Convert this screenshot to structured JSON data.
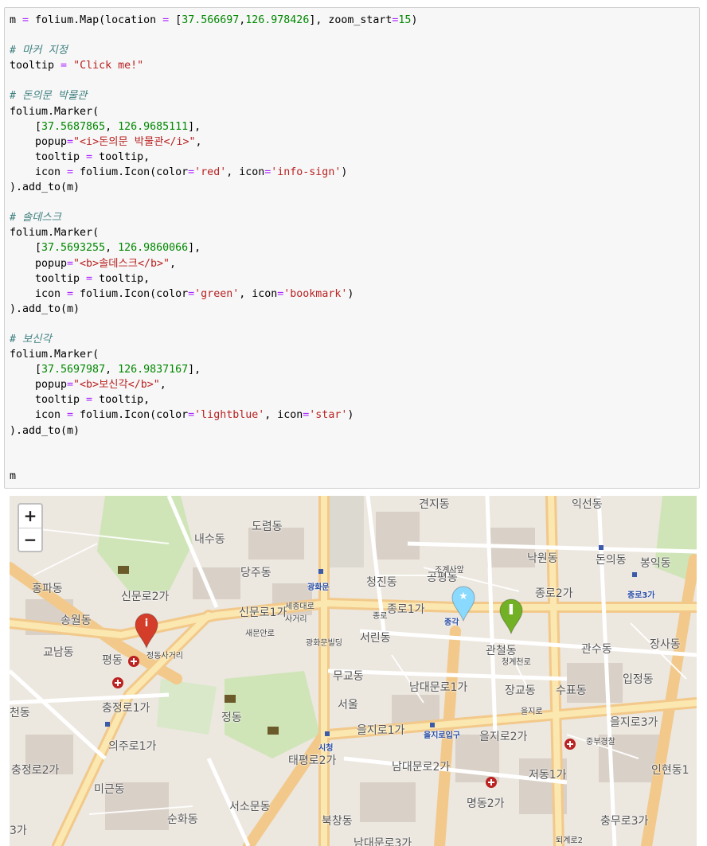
{
  "code_lines": [
    [
      {
        "t": "m "
      },
      {
        "t": "=",
        "c": "op"
      },
      {
        "t": " folium.Map(location "
      },
      {
        "t": "=",
        "c": "op"
      },
      {
        "t": " ["
      },
      {
        "t": "37.566697",
        "c": "num"
      },
      {
        "t": ","
      },
      {
        "t": "126.978426",
        "c": "num"
      },
      {
        "t": "], zoom_start"
      },
      {
        "t": "=",
        "c": "op"
      },
      {
        "t": "15",
        "c": "num"
      },
      {
        "t": ")"
      }
    ],
    [],
    [
      {
        "t": "# 마커 지정",
        "c": "cm"
      }
    ],
    [
      {
        "t": "tooltip "
      },
      {
        "t": "=",
        "c": "op"
      },
      {
        "t": " "
      },
      {
        "t": "\"Click me!\"",
        "c": "str"
      }
    ],
    [],
    [
      {
        "t": "# 돈의문 박물관",
        "c": "cm"
      }
    ],
    [
      {
        "t": "folium.Marker("
      }
    ],
    [
      {
        "i": 1
      },
      {
        "t": "["
      },
      {
        "t": "37.5687865",
        "c": "num"
      },
      {
        "t": ", "
      },
      {
        "t": "126.9685111",
        "c": "num"
      },
      {
        "t": "],"
      }
    ],
    [
      {
        "i": 1
      },
      {
        "t": "popup"
      },
      {
        "t": "=",
        "c": "op"
      },
      {
        "t": "\"<i>돈의문 박물관</i>\"",
        "c": "str"
      },
      {
        "t": ","
      }
    ],
    [
      {
        "i": 1
      },
      {
        "t": "tooltip "
      },
      {
        "t": "=",
        "c": "op"
      },
      {
        "t": " tooltip,"
      }
    ],
    [
      {
        "i": 1
      },
      {
        "t": "icon "
      },
      {
        "t": "=",
        "c": "op"
      },
      {
        "t": " folium.Icon(color"
      },
      {
        "t": "=",
        "c": "op"
      },
      {
        "t": "'red'",
        "c": "str"
      },
      {
        "t": ", icon"
      },
      {
        "t": "=",
        "c": "op"
      },
      {
        "t": "'info-sign'",
        "c": "str"
      },
      {
        "t": ")"
      }
    ],
    [
      {
        "t": ").add_to(m)"
      }
    ],
    [],
    [
      {
        "t": "# 솔데스크",
        "c": "cm"
      }
    ],
    [
      {
        "t": "folium.Marker("
      }
    ],
    [
      {
        "i": 1
      },
      {
        "t": "["
      },
      {
        "t": "37.5693255",
        "c": "num"
      },
      {
        "t": ", "
      },
      {
        "t": "126.9860066",
        "c": "num"
      },
      {
        "t": "],"
      }
    ],
    [
      {
        "i": 1
      },
      {
        "t": "popup"
      },
      {
        "t": "=",
        "c": "op"
      },
      {
        "t": "\"<b>솔데스크</b>\"",
        "c": "str"
      },
      {
        "t": ","
      }
    ],
    [
      {
        "i": 1
      },
      {
        "t": "tooltip "
      },
      {
        "t": "=",
        "c": "op"
      },
      {
        "t": " tooltip,"
      }
    ],
    [
      {
        "i": 1
      },
      {
        "t": "icon "
      },
      {
        "t": "=",
        "c": "op"
      },
      {
        "t": " folium.Icon(color"
      },
      {
        "t": "=",
        "c": "op"
      },
      {
        "t": "'green'",
        "c": "str"
      },
      {
        "t": ", icon"
      },
      {
        "t": "=",
        "c": "op"
      },
      {
        "t": "'bookmark'",
        "c": "str"
      },
      {
        "t": ")"
      }
    ],
    [
      {
        "t": ").add_to(m)"
      }
    ],
    [],
    [
      {
        "t": "# 보신각",
        "c": "cm"
      }
    ],
    [
      {
        "t": "folium.Marker("
      }
    ],
    [
      {
        "i": 1
      },
      {
        "t": "["
      },
      {
        "t": "37.5697987",
        "c": "num"
      },
      {
        "t": ", "
      },
      {
        "t": "126.9837167",
        "c": "num"
      },
      {
        "t": "],"
      }
    ],
    [
      {
        "i": 1
      },
      {
        "t": "popup"
      },
      {
        "t": "=",
        "c": "op"
      },
      {
        "t": "\"<b>보신각</b>\"",
        "c": "str"
      },
      {
        "t": ","
      }
    ],
    [
      {
        "i": 1
      },
      {
        "t": "tooltip "
      },
      {
        "t": "=",
        "c": "op"
      },
      {
        "t": " tooltip,"
      }
    ],
    [
      {
        "i": 1
      },
      {
        "t": "icon "
      },
      {
        "t": "=",
        "c": "op"
      },
      {
        "t": " folium.Icon(color"
      },
      {
        "t": "=",
        "c": "op"
      },
      {
        "t": "'lightblue'",
        "c": "str"
      },
      {
        "t": ", icon"
      },
      {
        "t": "=",
        "c": "op"
      },
      {
        "t": "'star'",
        "c": "str"
      },
      {
        "t": ")"
      }
    ],
    [
      {
        "t": ").add_to(m)"
      }
    ],
    [],
    [],
    [
      {
        "t": "m"
      }
    ]
  ],
  "map": {
    "zoom_in_label": "+",
    "zoom_out_label": "−",
    "markers": [
      {
        "name": "marker-donuimun-museum",
        "color": "#d33d29",
        "glyph": "i",
        "glyph_name": "info-sign-icon"
      },
      {
        "name": "marker-soldesk",
        "color": "#72b026",
        "glyph": "❚",
        "glyph_name": "bookmark-icon"
      },
      {
        "name": "marker-bosingak",
        "color": "#8adaff",
        "glyph": "★",
        "glyph_name": "star-icon"
      }
    ],
    "labels": [
      {
        "text": "도렴동",
        "cls": ""
      },
      {
        "text": "내수동",
        "cls": ""
      },
      {
        "text": "당주동",
        "cls": ""
      },
      {
        "text": "청진동",
        "cls": ""
      },
      {
        "text": "공평동",
        "cls": ""
      },
      {
        "text": "낙원동",
        "cls": ""
      },
      {
        "text": "돈의동",
        "cls": ""
      },
      {
        "text": "봉익동",
        "cls": ""
      },
      {
        "text": "익선동",
        "cls": ""
      },
      {
        "text": "견지동",
        "cls": ""
      },
      {
        "text": "홍파동",
        "cls": ""
      },
      {
        "text": "신문로2가",
        "cls": ""
      },
      {
        "text": "신문로1가",
        "cls": ""
      },
      {
        "text": "종로1가",
        "cls": ""
      },
      {
        "text": "종로2가",
        "cls": ""
      },
      {
        "text": "송월동",
        "cls": ""
      },
      {
        "text": "교남동",
        "cls": ""
      },
      {
        "text": "평동",
        "cls": ""
      },
      {
        "text": "서린동",
        "cls": ""
      },
      {
        "text": "관철동",
        "cls": ""
      },
      {
        "text": "관수동",
        "cls": ""
      },
      {
        "text": "장사동",
        "cls": ""
      },
      {
        "text": "무교동",
        "cls": ""
      },
      {
        "text": "남대문로1가",
        "cls": ""
      },
      {
        "text": "장교동",
        "cls": ""
      },
      {
        "text": "수표동",
        "cls": ""
      },
      {
        "text": "입정동",
        "cls": ""
      },
      {
        "text": "서울",
        "cls": ""
      },
      {
        "text": "충정로1가",
        "cls": ""
      },
      {
        "text": "정동",
        "cls": ""
      },
      {
        "text": "을지로1가",
        "cls": ""
      },
      {
        "text": "을지로2가",
        "cls": ""
      },
      {
        "text": "을지로3가",
        "cls": ""
      },
      {
        "text": "의주로1가",
        "cls": ""
      },
      {
        "text": "태평로2가",
        "cls": ""
      },
      {
        "text": "남대문로2가",
        "cls": ""
      },
      {
        "text": "저동1가",
        "cls": ""
      },
      {
        "text": "인현동1",
        "cls": ""
      },
      {
        "text": "충정로2가",
        "cls": ""
      },
      {
        "text": "미근동",
        "cls": ""
      },
      {
        "text": "서소문동",
        "cls": ""
      },
      {
        "text": "명동2가",
        "cls": ""
      },
      {
        "text": "순화동",
        "cls": ""
      },
      {
        "text": "북창동",
        "cls": ""
      },
      {
        "text": "충무로3가",
        "cls": ""
      },
      {
        "text": "남대문로3가",
        "cls": ""
      },
      {
        "text": "3가",
        "cls": ""
      },
      {
        "text": "천동",
        "cls": ""
      },
      {
        "text": "광화문",
        "cls": "blue"
      },
      {
        "text": "종각",
        "cls": "blue"
      },
      {
        "text": "종로3가",
        "cls": "blue"
      },
      {
        "text": "시청",
        "cls": "blue"
      },
      {
        "text": "을지로입구",
        "cls": "blue"
      },
      {
        "text": "세종대로",
        "cls": "s"
      },
      {
        "text": "사거리",
        "cls": "s"
      },
      {
        "text": "새문안로",
        "cls": "s"
      },
      {
        "text": "정동사거리",
        "cls": "s"
      },
      {
        "text": "광화문빌딩",
        "cls": "s"
      },
      {
        "text": "중부경찰",
        "cls": "s"
      },
      {
        "text": "조계사앞",
        "cls": "s"
      },
      {
        "text": "청계천로",
        "cls": "s"
      },
      {
        "text": "퇴계로2",
        "cls": "s"
      },
      {
        "text": "종로",
        "cls": "s"
      },
      {
        "text": "을지로",
        "cls": "s"
      }
    ]
  }
}
